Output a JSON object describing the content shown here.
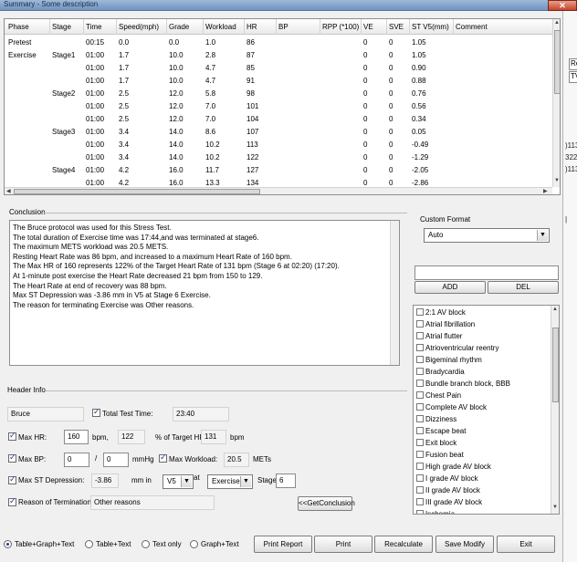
{
  "window": {
    "title": "Summary - Some  description"
  },
  "right_strip": {
    "labels": [
      "Re",
      "TV",
      ")113",
      "322",
      ")113",
      "|"
    ]
  },
  "table": {
    "columns": [
      "Phase",
      "Stage",
      "Time",
      "Speed(mph)",
      "Grade",
      "Workload",
      "HR",
      "BP",
      "RPP (*100)",
      "VE",
      "SVE",
      "ST V5(mm)",
      "Comment"
    ],
    "rows": [
      [
        "Pretest",
        "",
        "00:15",
        "0.0",
        "0.0",
        "1.0",
        "86",
        "",
        "",
        "0",
        "0",
        "1.05",
        ""
      ],
      [
        "Exercise",
        "Stage1",
        "01:00",
        "1.7",
        "10.0",
        "2.8",
        "87",
        "",
        "",
        "0",
        "0",
        "1.05",
        ""
      ],
      [
        "",
        "",
        "01:00",
        "1.7",
        "10.0",
        "4.7",
        "85",
        "",
        "",
        "0",
        "0",
        "0.90",
        ""
      ],
      [
        "",
        "",
        "01:00",
        "1.7",
        "10.0",
        "4.7",
        "91",
        "",
        "",
        "0",
        "0",
        "0.88",
        ""
      ],
      [
        "",
        "Stage2",
        "01:00",
        "2.5",
        "12.0",
        "5.8",
        "98",
        "",
        "",
        "0",
        "0",
        "0.76",
        ""
      ],
      [
        "",
        "",
        "01:00",
        "2.5",
        "12.0",
        "7.0",
        "101",
        "",
        "",
        "0",
        "0",
        "0.56",
        ""
      ],
      [
        "",
        "",
        "01:00",
        "2.5",
        "12.0",
        "7.0",
        "104",
        "",
        "",
        "0",
        "0",
        "0.34",
        ""
      ],
      [
        "",
        "Stage3",
        "01:00",
        "3.4",
        "14.0",
        "8.6",
        "107",
        "",
        "",
        "0",
        "0",
        "0.05",
        ""
      ],
      [
        "",
        "",
        "01:00",
        "3.4",
        "14.0",
        "10.2",
        "113",
        "",
        "",
        "0",
        "0",
        "-0.49",
        ""
      ],
      [
        "",
        "",
        "01:00",
        "3.4",
        "14.0",
        "10.2",
        "122",
        "",
        "",
        "0",
        "0",
        "-1.29",
        ""
      ],
      [
        "",
        "Stage4",
        "01:00",
        "4.2",
        "16.0",
        "11.7",
        "127",
        "",
        "",
        "0",
        "0",
        "-2.05",
        ""
      ],
      [
        "",
        "",
        "01:00",
        "4.2",
        "16.0",
        "13.3",
        "134",
        "",
        "",
        "0",
        "0",
        "-2.86",
        ""
      ]
    ]
  },
  "conclusion": {
    "label": "Conclusion",
    "lines": [
      "The Bruce protocol was used for this Stress Test.",
      "The total duration of Exercise time was 17:44,and was terminated at stage6.",
      "The maximum METS workload was 20.5 METS.",
      "Resting Heart Rate was 86 bpm, and increased to a maximum Heart Rate of 160 bpm.",
      "The Max HR of 160 represents 122% of the Target Heart Rate of 131 bpm  (Stage 6 at 02:20) (17:20).",
      "At 1-minute post exercise the Heart Rate decreased 21 bpm from 150 to 129.",
      "The Heart Rate at end of recovery was 88 bpm.",
      "Max ST Depression was -3.86 mm in V5 at Stage 6 Exercise.",
      "The reason for terminating Exercise was Other reasons."
    ]
  },
  "custom_format": {
    "label": "Custom Format",
    "selected": "Auto",
    "input_value": "",
    "add_label": "ADD",
    "del_label": "DEL",
    "items": [
      "2:1 AV block",
      "Atrial fibrillation",
      "Atrial flutter",
      "Atrioventricular reentry",
      "Bigeminal rhythm",
      "Bradycardia",
      "Bundle branch block, BBB",
      "Chest Pain",
      "Complete AV block",
      "Dizziness",
      "Escape beat",
      "Exit block",
      "Fusion beat",
      "High grade AV block",
      "I grade AV block",
      "II grade AV block",
      "III grade AV block",
      "Ischemia"
    ]
  },
  "header_info": {
    "label": "Header Info",
    "protocol": "Bruce",
    "total_test_time_label": "Total Test Time:",
    "total_test_time": "23:40",
    "max_hr_label": "Max HR:",
    "max_hr": "160",
    "bpm1": "bpm,",
    "pct_target": "122",
    "pct_target_label": "% of Target HR",
    "target_hr": "131",
    "bpm2": "bpm",
    "max_bp_label": "Max BP:",
    "bp_sys": "0",
    "slash": "/",
    "bp_dia": "0",
    "mmhg": "mmHg",
    "max_workload_label": "Max Workload:",
    "max_workload": "20.5",
    "mets": "METs",
    "max_st_label": "Max ST Depression:",
    "max_st": "-3.86",
    "mm_in": "mm in",
    "lead": "V5",
    "at": "at",
    "phase": "Exercise",
    "stage_label": "Stage",
    "stage": "6",
    "reason_label": "Reason of Termination:",
    "reason": "Other reasons",
    "get_conclusion": "<<GetConclusion"
  },
  "bottom": {
    "radios": [
      "Table+Graph+Text",
      "Table+Text",
      "Text only",
      "Graph+Text"
    ],
    "selected_radio": "Table+Graph+Text",
    "buttons": [
      "Print Report",
      "Print",
      "Recalculate",
      "Save Modify",
      "Exit"
    ]
  }
}
